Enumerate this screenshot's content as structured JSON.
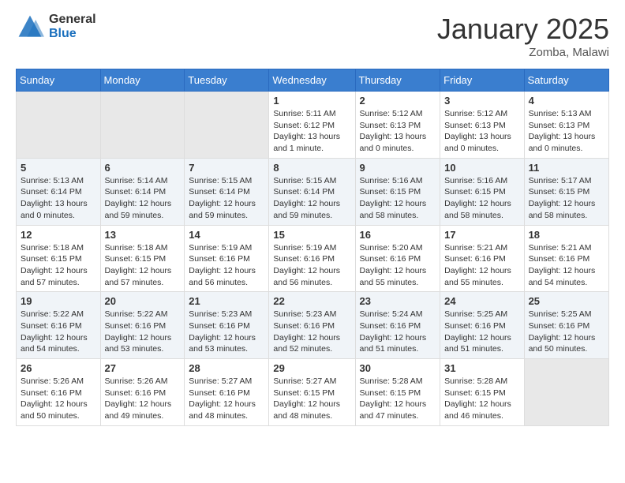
{
  "logo": {
    "general": "General",
    "blue": "Blue"
  },
  "header": {
    "month": "January 2025",
    "location": "Zomba, Malawi"
  },
  "days_of_week": [
    "Sunday",
    "Monday",
    "Tuesday",
    "Wednesday",
    "Thursday",
    "Friday",
    "Saturday"
  ],
  "weeks": [
    [
      {
        "day": "",
        "sunrise": "",
        "sunset": "",
        "daylight": ""
      },
      {
        "day": "",
        "sunrise": "",
        "sunset": "",
        "daylight": ""
      },
      {
        "day": "",
        "sunrise": "",
        "sunset": "",
        "daylight": ""
      },
      {
        "day": "1",
        "sunrise": "Sunrise: 5:11 AM",
        "sunset": "Sunset: 6:12 PM",
        "daylight": "Daylight: 13 hours and 1 minute."
      },
      {
        "day": "2",
        "sunrise": "Sunrise: 5:12 AM",
        "sunset": "Sunset: 6:13 PM",
        "daylight": "Daylight: 13 hours and 0 minutes."
      },
      {
        "day": "3",
        "sunrise": "Sunrise: 5:12 AM",
        "sunset": "Sunset: 6:13 PM",
        "daylight": "Daylight: 13 hours and 0 minutes."
      },
      {
        "day": "4",
        "sunrise": "Sunrise: 5:13 AM",
        "sunset": "Sunset: 6:13 PM",
        "daylight": "Daylight: 13 hours and 0 minutes."
      }
    ],
    [
      {
        "day": "5",
        "sunrise": "Sunrise: 5:13 AM",
        "sunset": "Sunset: 6:14 PM",
        "daylight": "Daylight: 13 hours and 0 minutes."
      },
      {
        "day": "6",
        "sunrise": "Sunrise: 5:14 AM",
        "sunset": "Sunset: 6:14 PM",
        "daylight": "Daylight: 12 hours and 59 minutes."
      },
      {
        "day": "7",
        "sunrise": "Sunrise: 5:15 AM",
        "sunset": "Sunset: 6:14 PM",
        "daylight": "Daylight: 12 hours and 59 minutes."
      },
      {
        "day": "8",
        "sunrise": "Sunrise: 5:15 AM",
        "sunset": "Sunset: 6:14 PM",
        "daylight": "Daylight: 12 hours and 59 minutes."
      },
      {
        "day": "9",
        "sunrise": "Sunrise: 5:16 AM",
        "sunset": "Sunset: 6:15 PM",
        "daylight": "Daylight: 12 hours and 58 minutes."
      },
      {
        "day": "10",
        "sunrise": "Sunrise: 5:16 AM",
        "sunset": "Sunset: 6:15 PM",
        "daylight": "Daylight: 12 hours and 58 minutes."
      },
      {
        "day": "11",
        "sunrise": "Sunrise: 5:17 AM",
        "sunset": "Sunset: 6:15 PM",
        "daylight": "Daylight: 12 hours and 58 minutes."
      }
    ],
    [
      {
        "day": "12",
        "sunrise": "Sunrise: 5:18 AM",
        "sunset": "Sunset: 6:15 PM",
        "daylight": "Daylight: 12 hours and 57 minutes."
      },
      {
        "day": "13",
        "sunrise": "Sunrise: 5:18 AM",
        "sunset": "Sunset: 6:15 PM",
        "daylight": "Daylight: 12 hours and 57 minutes."
      },
      {
        "day": "14",
        "sunrise": "Sunrise: 5:19 AM",
        "sunset": "Sunset: 6:16 PM",
        "daylight": "Daylight: 12 hours and 56 minutes."
      },
      {
        "day": "15",
        "sunrise": "Sunrise: 5:19 AM",
        "sunset": "Sunset: 6:16 PM",
        "daylight": "Daylight: 12 hours and 56 minutes."
      },
      {
        "day": "16",
        "sunrise": "Sunrise: 5:20 AM",
        "sunset": "Sunset: 6:16 PM",
        "daylight": "Daylight: 12 hours and 55 minutes."
      },
      {
        "day": "17",
        "sunrise": "Sunrise: 5:21 AM",
        "sunset": "Sunset: 6:16 PM",
        "daylight": "Daylight: 12 hours and 55 minutes."
      },
      {
        "day": "18",
        "sunrise": "Sunrise: 5:21 AM",
        "sunset": "Sunset: 6:16 PM",
        "daylight": "Daylight: 12 hours and 54 minutes."
      }
    ],
    [
      {
        "day": "19",
        "sunrise": "Sunrise: 5:22 AM",
        "sunset": "Sunset: 6:16 PM",
        "daylight": "Daylight: 12 hours and 54 minutes."
      },
      {
        "day": "20",
        "sunrise": "Sunrise: 5:22 AM",
        "sunset": "Sunset: 6:16 PM",
        "daylight": "Daylight: 12 hours and 53 minutes."
      },
      {
        "day": "21",
        "sunrise": "Sunrise: 5:23 AM",
        "sunset": "Sunset: 6:16 PM",
        "daylight": "Daylight: 12 hours and 53 minutes."
      },
      {
        "day": "22",
        "sunrise": "Sunrise: 5:23 AM",
        "sunset": "Sunset: 6:16 PM",
        "daylight": "Daylight: 12 hours and 52 minutes."
      },
      {
        "day": "23",
        "sunrise": "Sunrise: 5:24 AM",
        "sunset": "Sunset: 6:16 PM",
        "daylight": "Daylight: 12 hours and 51 minutes."
      },
      {
        "day": "24",
        "sunrise": "Sunrise: 5:25 AM",
        "sunset": "Sunset: 6:16 PM",
        "daylight": "Daylight: 12 hours and 51 minutes."
      },
      {
        "day": "25",
        "sunrise": "Sunrise: 5:25 AM",
        "sunset": "Sunset: 6:16 PM",
        "daylight": "Daylight: 12 hours and 50 minutes."
      }
    ],
    [
      {
        "day": "26",
        "sunrise": "Sunrise: 5:26 AM",
        "sunset": "Sunset: 6:16 PM",
        "daylight": "Daylight: 12 hours and 50 minutes."
      },
      {
        "day": "27",
        "sunrise": "Sunrise: 5:26 AM",
        "sunset": "Sunset: 6:16 PM",
        "daylight": "Daylight: 12 hours and 49 minutes."
      },
      {
        "day": "28",
        "sunrise": "Sunrise: 5:27 AM",
        "sunset": "Sunset: 6:16 PM",
        "daylight": "Daylight: 12 hours and 48 minutes."
      },
      {
        "day": "29",
        "sunrise": "Sunrise: 5:27 AM",
        "sunset": "Sunset: 6:15 PM",
        "daylight": "Daylight: 12 hours and 48 minutes."
      },
      {
        "day": "30",
        "sunrise": "Sunrise: 5:28 AM",
        "sunset": "Sunset: 6:15 PM",
        "daylight": "Daylight: 12 hours and 47 minutes."
      },
      {
        "day": "31",
        "sunrise": "Sunrise: 5:28 AM",
        "sunset": "Sunset: 6:15 PM",
        "daylight": "Daylight: 12 hours and 46 minutes."
      },
      {
        "day": "",
        "sunrise": "",
        "sunset": "",
        "daylight": ""
      }
    ]
  ]
}
